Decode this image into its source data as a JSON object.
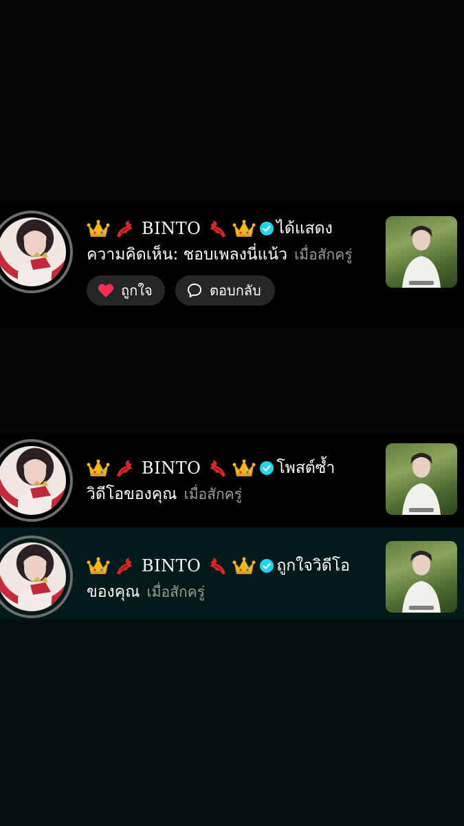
{
  "notifications": [
    {
      "username": "BINTO",
      "action": "ได้แสดง",
      "text": "ความคิดเห็น: ชอบเพลงนี่แน้ว",
      "time": "เมื่อสักครู่",
      "buttons": {
        "like": "ถูกใจ",
        "reply": "ตอบกลับ"
      }
    },
    {
      "username": "BINTO",
      "action": "โพสต์ซ้ำ",
      "text": "วิดีโอของคุณ",
      "time": "เมื่อสักครู่"
    },
    {
      "username": "BINTO",
      "action": "ถูกใจวิดีโอ",
      "text": "ของคุณ",
      "time": "เมื่อสักครู่"
    }
  ],
  "colors": {
    "verified": "#20d5ec",
    "heart": "#fe2c55",
    "time": "#9b9b9b"
  },
  "icons": [
    "crown-icon",
    "dragon-icon",
    "verified-icon",
    "heart-icon",
    "reply-bubble-icon"
  ]
}
